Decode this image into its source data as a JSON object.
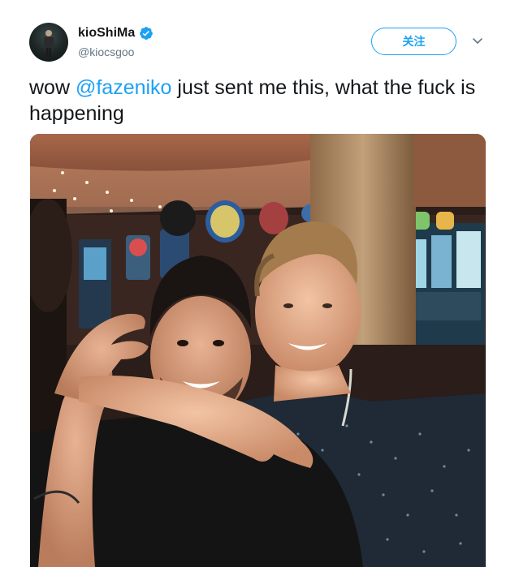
{
  "tweet": {
    "display_name": "kioShiMa",
    "handle": "@kiocsgoo",
    "follow_label": "关注",
    "text_before": "wow ",
    "mention": "@fazeniko",
    "text_after": " just sent me this, what the fuck is happening",
    "verified_icon": "verified-badge-icon",
    "caret_icon": "chevron-down-icon"
  },
  "colors": {
    "accent": "#1da1f2",
    "handle_gray": "#657786",
    "text": "#14171a"
  }
}
